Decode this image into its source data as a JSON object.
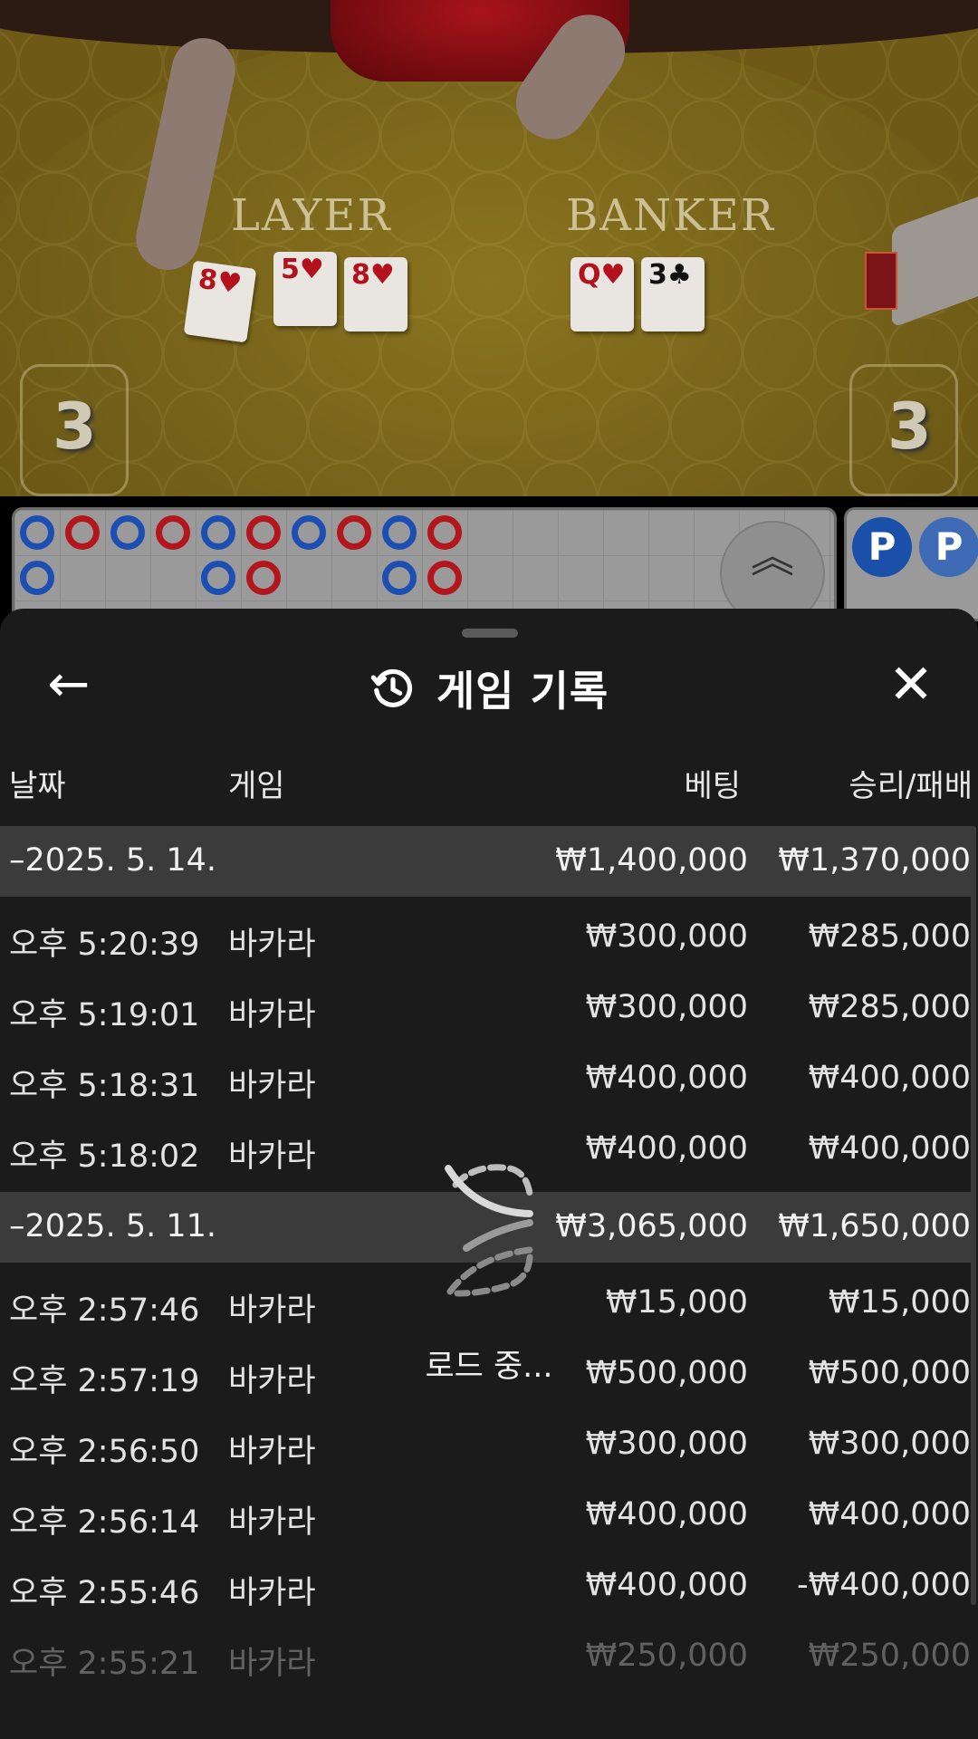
{
  "table": {
    "player_label": "LAYER",
    "banker_label": "BANKER",
    "player_score": "3",
    "banker_score": "3",
    "player_cards": [
      {
        "rank": "8",
        "suit": "♥",
        "color": "red"
      },
      {
        "rank": "5",
        "suit": "♥",
        "color": "red"
      },
      {
        "rank": "8",
        "suit": "♥",
        "color": "red"
      }
    ],
    "banker_cards": [
      {
        "rank": "Q",
        "suit": "♥",
        "color": "red"
      },
      {
        "rank": "3",
        "suit": "♣",
        "color": "black"
      }
    ]
  },
  "road": {
    "expand_icon": "︽",
    "chip_label": "P",
    "beads": [
      {
        "col": 0,
        "row": 0,
        "result": "P"
      },
      {
        "col": 1,
        "row": 0,
        "result": "B"
      },
      {
        "col": 2,
        "row": 0,
        "result": "P"
      },
      {
        "col": 3,
        "row": 0,
        "result": "B"
      },
      {
        "col": 4,
        "row": 0,
        "result": "P"
      },
      {
        "col": 5,
        "row": 0,
        "result": "B"
      },
      {
        "col": 6,
        "row": 0,
        "result": "P"
      },
      {
        "col": 7,
        "row": 0,
        "result": "B"
      },
      {
        "col": 8,
        "row": 0,
        "result": "P"
      },
      {
        "col": 9,
        "row": 0,
        "result": "B"
      },
      {
        "col": 0,
        "row": 1,
        "result": "P"
      },
      {
        "col": 4,
        "row": 1,
        "result": "P"
      },
      {
        "col": 5,
        "row": 1,
        "result": "B"
      },
      {
        "col": 8,
        "row": 1,
        "result": "P"
      },
      {
        "col": 9,
        "row": 1,
        "result": "B"
      }
    ]
  },
  "sheet": {
    "title": "게임 기록",
    "back_icon": "←",
    "close_icon": "✕",
    "columns": {
      "date": "날짜",
      "game": "게임",
      "bet": "베팅",
      "winloss": "승리/패배"
    },
    "groups": [
      {
        "date": "–2025. 5. 14.",
        "bet": "₩1,400,000",
        "winloss": "₩1,370,000",
        "rows": [
          {
            "time": "오후 5:20:39",
            "game": "바카라",
            "bet": "₩300,000",
            "winloss": "₩285,000"
          },
          {
            "time": "오후 5:19:01",
            "game": "바카라",
            "bet": "₩300,000",
            "winloss": "₩285,000"
          },
          {
            "time": "오후 5:18:31",
            "game": "바카라",
            "bet": "₩400,000",
            "winloss": "₩400,000"
          },
          {
            "time": "오후 5:18:02",
            "game": "바카라",
            "bet": "₩400,000",
            "winloss": "₩400,000"
          }
        ]
      },
      {
        "date": "–2025. 5. 11.",
        "bet": "₩3,065,000",
        "winloss": "₩1,650,000",
        "rows": [
          {
            "time": "오후 2:57:46",
            "game": "바카라",
            "bet": "₩15,000",
            "winloss": "₩15,000"
          },
          {
            "time": "오후 2:57:19",
            "game": "바카라",
            "bet": "₩500,000",
            "winloss": "₩500,000"
          },
          {
            "time": "오후 2:56:50",
            "game": "바카라",
            "bet": "₩300,000",
            "winloss": "₩300,000"
          },
          {
            "time": "오후 2:56:14",
            "game": "바카라",
            "bet": "₩400,000",
            "winloss": "₩400,000"
          },
          {
            "time": "오후 2:55:46",
            "game": "바카라",
            "bet": "₩400,000",
            "winloss": "-₩400,000"
          },
          {
            "time": "오후 2:55:21",
            "game": "바카라",
            "bet": "₩250,000",
            "winloss": "₩250,000"
          }
        ]
      }
    ],
    "loading_text": "로드 중..."
  }
}
